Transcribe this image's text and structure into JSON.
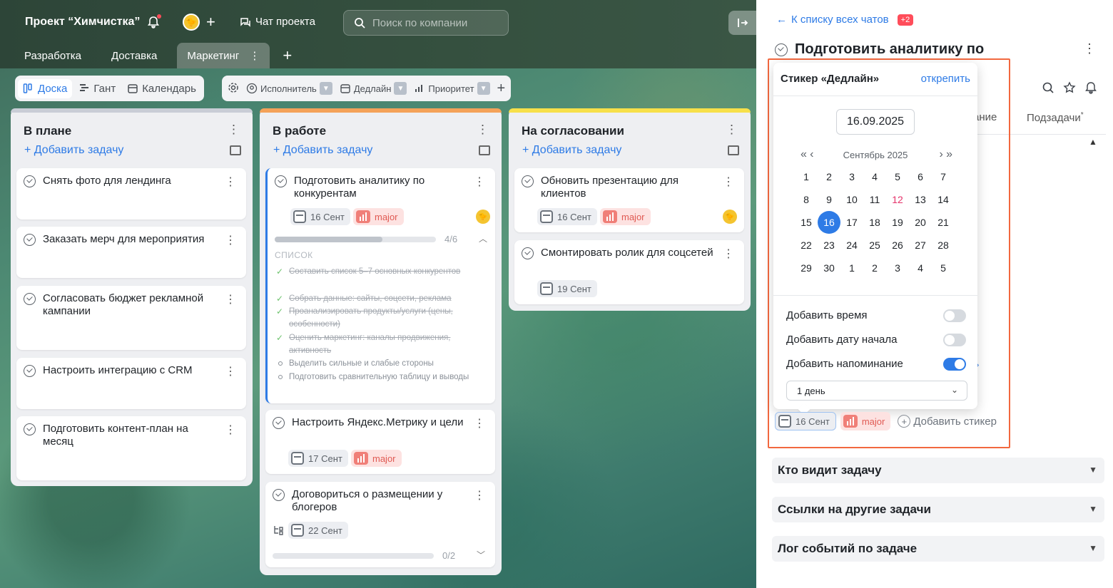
{
  "header": {
    "project_title": "Проект “Химчистка”",
    "chat_label": "Чат проекта",
    "search_placeholder": "Поиск по компании"
  },
  "tabs": [
    {
      "label": "Разработка"
    },
    {
      "label": "Доставка"
    },
    {
      "label": "Маркетинг",
      "active": true
    }
  ],
  "views": [
    {
      "label": "Доска",
      "active": true
    },
    {
      "label": "Гант"
    },
    {
      "label": "Календарь"
    }
  ],
  "filters": [
    {
      "label": "Исполнитель"
    },
    {
      "label": "Дедлайн"
    },
    {
      "label": "Приоритет"
    }
  ],
  "add_task_label": "+ Добавить задачу",
  "columns": [
    {
      "title": "В плане",
      "accent": "#c9cdd6",
      "cards": [
        {
          "title": "Снять фото для лендинга"
        },
        {
          "title": "Заказать мерч для мероприятия"
        },
        {
          "title": "Согласовать бюджет рекламной кампании"
        },
        {
          "title": "Настроить интеграцию с CRM"
        },
        {
          "title": "Подготовить контент-план на месяц"
        }
      ]
    },
    {
      "title": "В работе",
      "accent": "#f4a259",
      "cards": [
        {
          "title": "Подготовить аналитику по конкурентам",
          "date": "16 Сент",
          "priority": "major",
          "progress": "4/6",
          "progress_fraction": 0.67,
          "checklist_title": "СПИСОК",
          "checklist": [
            {
              "text": "Составить список 5–7 основных конкурентов",
              "done": true
            },
            {
              "text": "Собрать данные: сайты, соцсети, реклама",
              "done": true
            },
            {
              "text": "Проанализировать продукты/услуги (цены, особенности)",
              "done": true
            },
            {
              "text": "Оценить маркетинг: каналы продвижения, активность",
              "done": true
            },
            {
              "text": "Выделить сильные и слабые стороны",
              "done": false
            },
            {
              "text": "Подготовить сравнительную таблицу и выводы",
              "done": false
            }
          ]
        },
        {
          "title": "Настроить Яндекс.Метрику и цели",
          "date": "17 Сент",
          "priority": "major"
        },
        {
          "title": "Договориться о размещении у блогеров",
          "date": "22 Сент",
          "progress": "0/2",
          "progress_fraction": 0
        }
      ]
    },
    {
      "title": "На согласовании",
      "accent": "#f7e04a",
      "cards": [
        {
          "title": "Обновить презентацию для клиентов",
          "date": "16 Сент",
          "priority": "major"
        },
        {
          "title": "Смонтировать ролик для соцсетей",
          "date": "19 Сент"
        }
      ]
    }
  ],
  "panel": {
    "back_label": "К списку всех чатов",
    "back_badge": "+2",
    "task_title": "Подготовить аналитику по",
    "tab_partial": "ание",
    "tab_subtasks": "Подзадачи",
    "subtasks_mark": "*",
    "accordions": [
      {
        "label": "Кто видит задачу"
      },
      {
        "label": "Ссылки на другие задачи"
      },
      {
        "label": "Лог событий по задаче"
      }
    ],
    "sticker_date": "16 Сент",
    "sticker_priority": "major",
    "add_sticker": "Добавить стикер"
  },
  "popup": {
    "title": "Стикер «Дедлайн»",
    "unpin": "открепить",
    "date_value": "16.09.2025",
    "month_label": "Сентябрь 2025",
    "days": [
      "1",
      "2",
      "3",
      "4",
      "5",
      "6",
      "7",
      "8",
      "9",
      "10",
      "11",
      "12",
      "13",
      "14",
      "15",
      "16",
      "17",
      "18",
      "19",
      "20",
      "21",
      "22",
      "23",
      "24",
      "25",
      "26",
      "27",
      "28",
      "29",
      "30",
      "1",
      "2",
      "3",
      "4",
      "5"
    ],
    "selected_day": "16",
    "today_day": "12",
    "options": [
      {
        "label": "Добавить время",
        "on": false
      },
      {
        "label": "Добавить дату начала",
        "on": false
      },
      {
        "label": "Добавить напоминание",
        "on": true
      }
    ],
    "reminder_value": "1 день"
  },
  "colors": {
    "accent": "#2e7be6",
    "highlight": "#f2683f",
    "major": "#e05a53"
  }
}
